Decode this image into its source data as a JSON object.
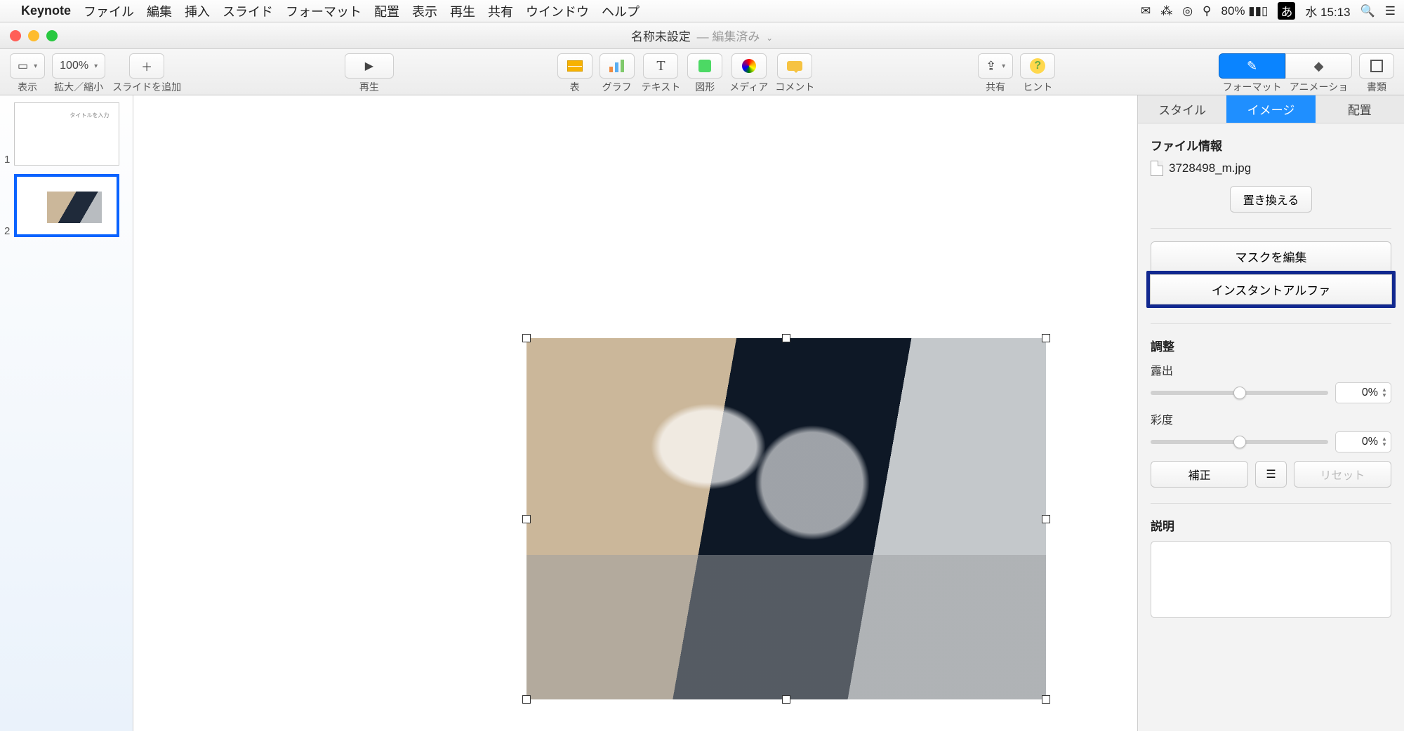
{
  "menubar": {
    "app": "Keynote",
    "items": [
      "ファイル",
      "編集",
      "挿入",
      "スライド",
      "フォーマット",
      "配置",
      "表示",
      "再生",
      "共有",
      "ウインドウ",
      "ヘルプ"
    ],
    "right": {
      "battery_pct": "80%",
      "ime": "あ",
      "clock": "水 15:13"
    }
  },
  "window": {
    "title": "名称未設定",
    "subtitle": "— 編集済み"
  },
  "toolbar": {
    "view": "表示",
    "zoom": "拡大／縮小",
    "zoom_value": "100%",
    "add_slide": "スライドを追加",
    "play": "再生",
    "table": "表",
    "chart": "グラフ",
    "text": "テキスト",
    "shape": "図形",
    "media": "メディア",
    "comment": "コメント",
    "share": "共有",
    "hint": "ヒント",
    "format": "フォーマット",
    "animation": "アニメーション",
    "document": "書類"
  },
  "slides": {
    "s1": "1",
    "s2": "2"
  },
  "inspector": {
    "tabs": {
      "style": "スタイル",
      "image": "イメージ",
      "arrange": "配置"
    },
    "file_info_label": "ファイル情報",
    "file_name": "3728498_m.jpg",
    "replace": "置き換える",
    "edit_mask": "マスクを編集",
    "instant_alpha": "インスタントアルファ",
    "adjust": "調整",
    "exposure": "露出",
    "exposure_val": "0%",
    "saturation": "彩度",
    "saturation_val": "0%",
    "enhance": "補正",
    "reset": "リセット",
    "description": "説明"
  }
}
